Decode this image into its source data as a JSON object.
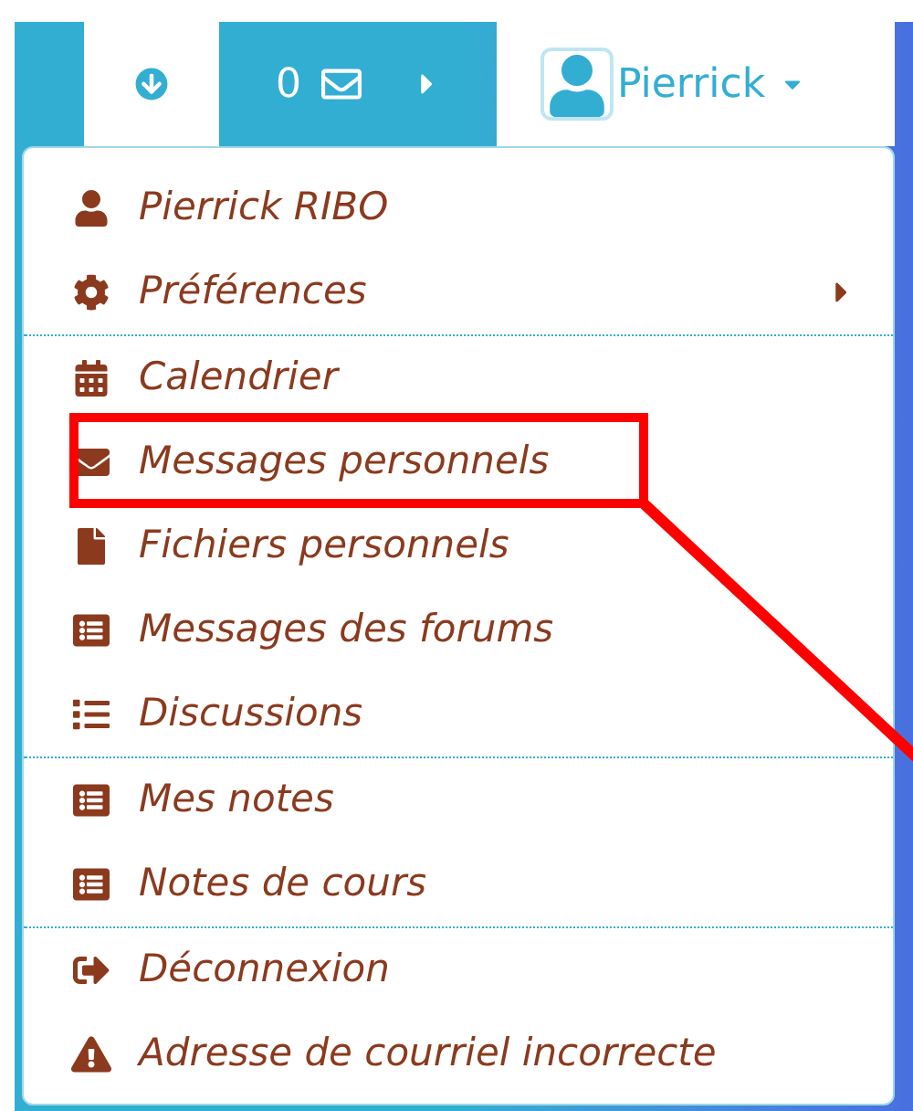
{
  "navbar": {
    "messages_count": "0",
    "user_name": "Pierrick"
  },
  "menu": {
    "groups": [
      [
        {
          "label": "Pierrick RIBO",
          "has_submenu": false,
          "highlighted": false
        },
        {
          "label": "Préférences",
          "has_submenu": true,
          "highlighted": false
        }
      ],
      [
        {
          "label": "Calendrier",
          "has_submenu": false,
          "highlighted": false
        },
        {
          "label": "Messages personnels",
          "has_submenu": false,
          "highlighted": true
        },
        {
          "label": "Fichiers personnels",
          "has_submenu": false,
          "highlighted": false
        },
        {
          "label": "Messages des forums",
          "has_submenu": false,
          "highlighted": false
        },
        {
          "label": "Discussions",
          "has_submenu": false,
          "highlighted": false
        }
      ],
      [
        {
          "label": "Mes notes",
          "has_submenu": false,
          "highlighted": false
        },
        {
          "label": "Notes de cours",
          "has_submenu": false,
          "highlighted": false
        }
      ],
      [
        {
          "label": "Déconnexion",
          "has_submenu": false,
          "highlighted": false
        },
        {
          "label": "Adresse de courriel incorrecte",
          "has_submenu": false,
          "highlighted": false
        }
      ]
    ]
  }
}
